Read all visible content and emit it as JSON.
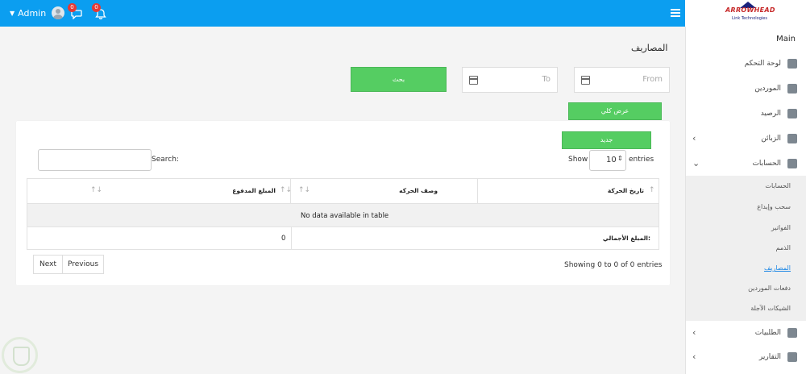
{
  "header": {
    "user_name": "Admin",
    "messages_count": "0",
    "notifications_count": "0",
    "logo_text": "ARROWHEAD",
    "logo_subtitle": "Link Technologies"
  },
  "sidebar": {
    "section_title": "Main",
    "items": [
      {
        "label": "لوحة التحكم"
      },
      {
        "label": "الموردين"
      },
      {
        "label": "الرصيد"
      },
      {
        "label": "الزبائن"
      },
      {
        "label": "الحسابات"
      }
    ],
    "sub_items": [
      {
        "label": "الحسابات"
      },
      {
        "label": "سحب وإيداع"
      },
      {
        "label": "الفواتير"
      },
      {
        "label": "الذمم"
      },
      {
        "label": "المصاريف"
      },
      {
        "label": "دفعات الموردين"
      },
      {
        "label": "الشيكات الآجلة"
      }
    ],
    "bottom_items": [
      {
        "label": "الطلبيات"
      },
      {
        "label": "التقارير"
      }
    ]
  },
  "page": {
    "title": "المصاريف",
    "from_placeholder": "From",
    "to_placeholder": "To",
    "search_button": "بحث",
    "show_all_button": "عرض كلي",
    "new_button": "جديد"
  },
  "table_controls": {
    "show_label": "Show",
    "entries_value": "10",
    "entries_label": "entries",
    "search_label": "Search:",
    "showing_text": "Showing 0 to 0 of 0 entries",
    "next_label": "Next",
    "previous_label": "Previous"
  },
  "table": {
    "headers": [
      "تاريخ الحركة",
      "وصف الحركه",
      "المبلغ المدفوع"
    ],
    "empty_text": "No data available in table",
    "total_label": "المبلغ الأجمالي:",
    "total_value": "0"
  },
  "colors": {
    "topbar": "#0b9ef0",
    "accent_green": "#55cd62",
    "badge_red": "#e53935",
    "active_link": "#1e88e5"
  }
}
